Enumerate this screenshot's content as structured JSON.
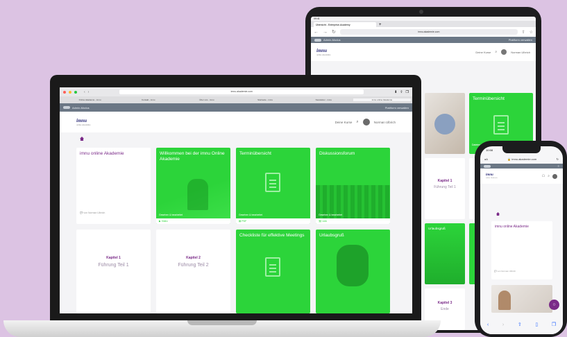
{
  "tablet": {
    "status_time": "09:41",
    "tab_title": "Übersicht - Enterprise-Academy",
    "url": "imnu.akademie.com",
    "topbar_left": "Admin-Modus",
    "topbar_right": "Plattform verwalten",
    "header_courses": "Deine Kurse",
    "header_user": "Norman Ulbrich",
    "card_termin": "Terminübersicht",
    "card_termin_sub": "Dateien & bearbeitet",
    "card_kapitel1": "Kapitel 1",
    "card_fuehrung1": "Führung Teil 1",
    "card_urlaub": "Urlaubsgruß",
    "card_kapitel3": "Kapitel 3",
    "card_ende": "Ende"
  },
  "laptop": {
    "url": "imnu.akademie.com",
    "bookmarks": [
      "Online Akademie - imnu",
      "Kontakt - imnu",
      "Über uns - imnu",
      "Startseite - imnu",
      "Newsletter - imnu",
      "imnu online Akademie"
    ],
    "topbar_left": "Admin-Modus",
    "topbar_right": "Plattform verwalten",
    "logo": "imnu",
    "logo_sub": "online Akademie",
    "header_courses": "Deine Kurse",
    "header_user": "Norman Ulbrich",
    "cards": {
      "akademie_title": "imnu online Akademie",
      "akademie_author": "von Norman Ulbrich",
      "welcome_title": "Willkommen bei der imnu Online Akademie",
      "welcome_sub": "Gesehen & bearbeitet",
      "welcome_meta": "Video",
      "termin_title": "Terminübersicht",
      "termin_sub": "Gesehen & bearbeitet",
      "termin_meta": "PDF",
      "forum_title": "Diskussionsforum",
      "forum_sub": "Gesehen & bearbeitet",
      "forum_meta": "Link",
      "kap1_label": "Kapitel 1",
      "kap1_title": "Führung Teil 1",
      "kap2_label": "Kapitel 2",
      "kap2_title": "Führung Teil 2",
      "checklist_title": "Checkliste für effektive Meetings",
      "urlaub_title": "Urlaubsgruß"
    }
  },
  "phone": {
    "status_time": "10:58",
    "url": "imnu.akademie.com",
    "card_title": "imnu online Akademie",
    "card_author": "von Norman Ulbrich"
  },
  "colors": {
    "accent_green": "#2cd43a",
    "brand_purple": "#7a2a88",
    "topbar": "#6b7785",
    "background": "#dcc3e3"
  }
}
